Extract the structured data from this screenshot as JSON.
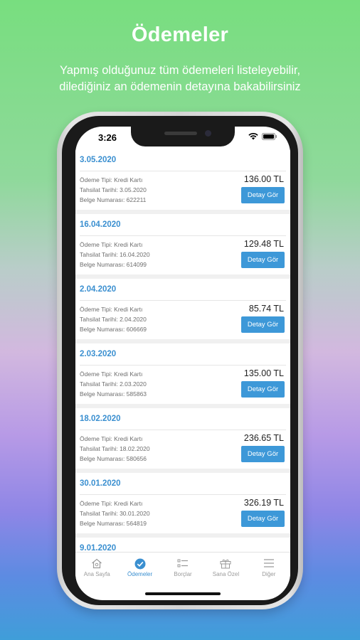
{
  "promo": {
    "title": "Ödemeler",
    "subtitle_line1": "Yapmış olduğunuz tüm ödemeleri listeleyebilir,",
    "subtitle_line2": "dilediğiniz an ödemenin detayına bakabilirsiniz"
  },
  "status_bar": {
    "time": "3:26"
  },
  "payments": [
    {
      "date": "3.05.2020",
      "type": "Ödeme Tipi: Kredi Kartı",
      "collection": "Tahsilat Tarihi: 3.05.2020",
      "doc": "Belge Numarası: 622211",
      "amount": "136.00 TL",
      "button": "Detay Gör"
    },
    {
      "date": "16.04.2020",
      "type": "Ödeme Tipi: Kredi Kartı",
      "collection": "Tahsilat Tarihi: 16.04.2020",
      "doc": "Belge Numarası: 614099",
      "amount": "129.48 TL",
      "button": "Detay Gör"
    },
    {
      "date": "2.04.2020",
      "type": "Ödeme Tipi: Kredi Kartı",
      "collection": "Tahsilat Tarihi: 2.04.2020",
      "doc": "Belge Numarası: 606669",
      "amount": "85.74 TL",
      "button": "Detay Gör"
    },
    {
      "date": "2.03.2020",
      "type": "Ödeme Tipi: Kredi Kartı",
      "collection": "Tahsilat Tarihi: 2.03.2020",
      "doc": "Belge Numarası: 585863",
      "amount": "135.00 TL",
      "button": "Detay Gör"
    },
    {
      "date": "18.02.2020",
      "type": "Ödeme Tipi: Kredi Kartı",
      "collection": "Tahsilat Tarihi: 18.02.2020",
      "doc": "Belge Numarası: 580656",
      "amount": "236.65 TL",
      "button": "Detay Gör"
    },
    {
      "date": "30.01.2020",
      "type": "Ödeme Tipi: Kredi Kartı",
      "collection": "Tahsilat Tarihi: 30.01.2020",
      "doc": "Belge Numarası: 564819",
      "amount": "326.19 TL",
      "button": "Detay Gör"
    },
    {
      "date": "9.01.2020",
      "type": "",
      "collection": "",
      "doc": "",
      "amount": "",
      "button": ""
    }
  ],
  "tabs": [
    {
      "label": "Ana Sayfa",
      "icon": "home-icon",
      "active": false
    },
    {
      "label": "Ödemeler",
      "icon": "check-circle-icon",
      "active": true
    },
    {
      "label": "Borçlar",
      "icon": "list-icon",
      "active": false
    },
    {
      "label": "Sana Özel",
      "icon": "gift-icon",
      "active": false
    },
    {
      "label": "Diğer",
      "icon": "menu-icon",
      "active": false
    }
  ],
  "colors": {
    "accent": "#3a8fd0",
    "button": "#3d98d8",
    "inactive_tab": "#9a9a9a"
  }
}
